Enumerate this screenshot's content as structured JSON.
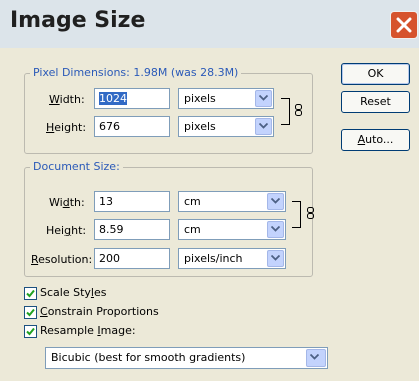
{
  "window": {
    "title": "Image Size",
    "close_icon": "close-icon"
  },
  "pixel_dimensions": {
    "legend": "Pixel Dimensions:  1.98M (was 28.3M)",
    "width_label": "Width:",
    "width_value": "1024",
    "width_unit": "pixels",
    "height_label": "Height:",
    "height_value": "676",
    "height_unit": "pixels",
    "link_icon": "chain-link-icon"
  },
  "document_size": {
    "legend": "Document Size:",
    "width_label": "Width:",
    "width_value": "13",
    "width_unit": "cm",
    "height_label": "Height:",
    "height_value": "8.59",
    "height_unit": "cm",
    "resolution_label": "Resolution:",
    "resolution_value": "200",
    "resolution_unit": "pixels/inch",
    "link_icon": "chain-link-icon"
  },
  "buttons": {
    "ok": "OK",
    "reset": "Reset",
    "auto": "Auto..."
  },
  "options": {
    "scale_styles": {
      "label": "Scale Styles",
      "checked": true
    },
    "constrain_proportions": {
      "label": "Constrain Proportions",
      "checked": true
    },
    "resample_image": {
      "label": "Resample Image:",
      "checked": true
    },
    "resample_method": "Bicubic (best for smooth gradients)"
  },
  "colors": {
    "dialog_bg": "#ece9d8",
    "legend_blue": "#2b5ab8",
    "close_red": "#d6532d",
    "check_green": "#21a121"
  }
}
